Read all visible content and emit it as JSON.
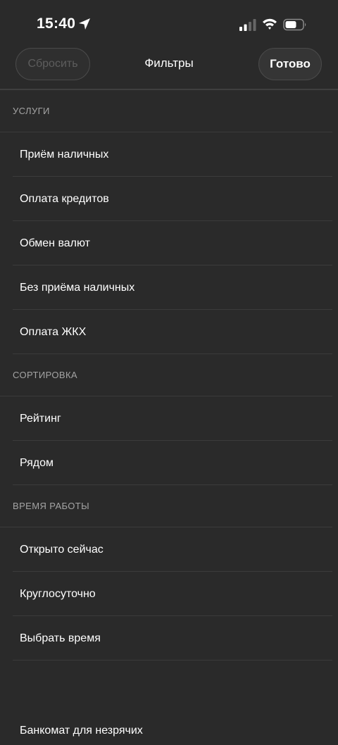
{
  "status": {
    "time": "15:40"
  },
  "nav": {
    "reset_label": "Сбросить",
    "title": "Фильтры",
    "done_label": "Готово"
  },
  "sections": [
    {
      "header": "УСЛУГИ",
      "items": [
        "Приём наличных",
        "Оплата кредитов",
        "Обмен валют",
        "Без приёма наличных",
        "Оплата ЖКХ"
      ]
    },
    {
      "header": "СОРТИРОВКА",
      "items": [
        "Рейтинг",
        "Рядом"
      ]
    },
    {
      "header": "ВРЕМЯ РАБОТЫ",
      "items": [
        "Открыто сейчас",
        "Круглосуточно",
        "Выбрать время"
      ]
    }
  ],
  "extra": {
    "cut_item": "Банкомат для незрячих"
  },
  "colors": {
    "background": "#2a2a2a",
    "divider": "#3b3b3b",
    "header_text": "#a4a4a4",
    "disabled_text": "#5d5d5d"
  }
}
